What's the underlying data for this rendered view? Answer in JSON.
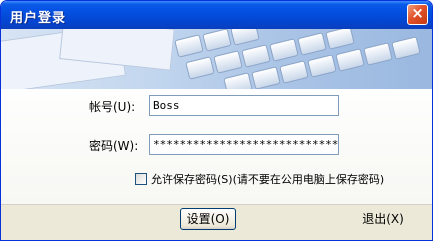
{
  "window": {
    "title": "用户登录",
    "close_label": "×"
  },
  "form": {
    "account_label": "帐号(U):",
    "account_value": "Boss",
    "password_label": "密码(W):",
    "password_value": "******************************",
    "save_password_label": "允许保存密码(S)(请不要在公用电脑上保存密码)",
    "save_password_checked": false
  },
  "buttons": {
    "settings": "设置(O)",
    "exit": "退出(X)"
  },
  "colors": {
    "titlebar": "#0a5ae8",
    "close": "#e3522a",
    "field_border": "#7f9db9"
  }
}
